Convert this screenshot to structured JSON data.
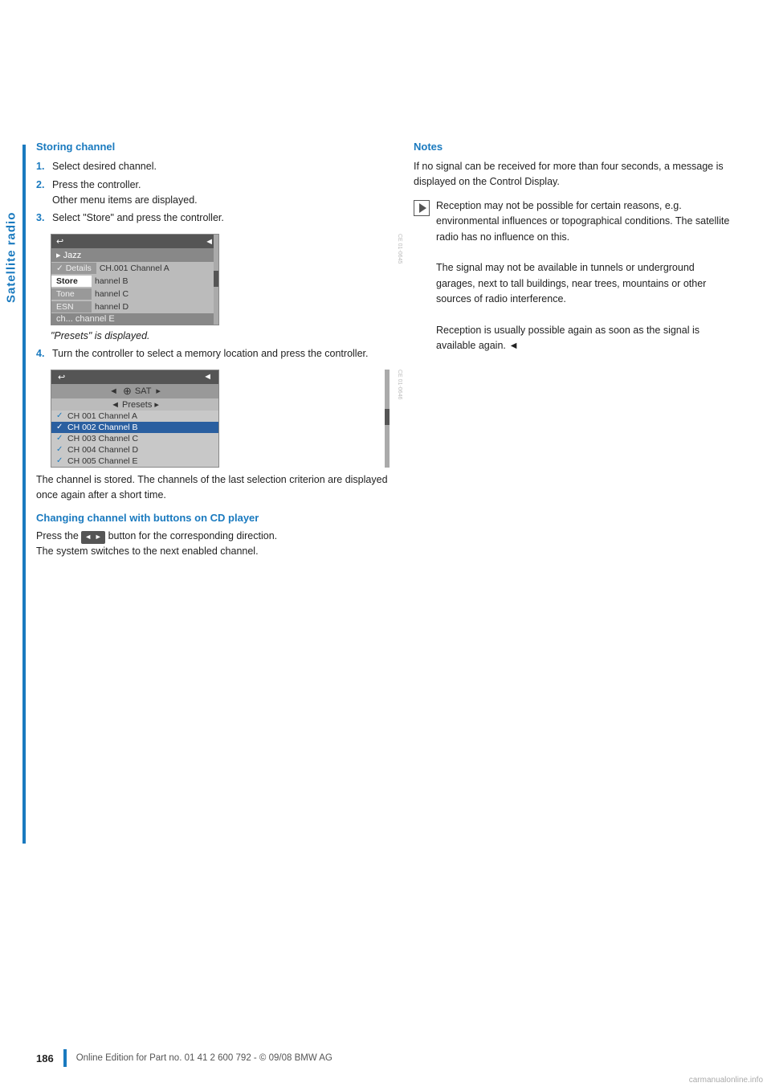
{
  "sidebar": {
    "label": "Satellite radio"
  },
  "left_col": {
    "storing_channel": {
      "title": "Storing channel",
      "steps": [
        {
          "num": "1.",
          "text": "Select desired channel."
        },
        {
          "num": "2.",
          "text": "Press the controller.\nOther menu items are displayed."
        },
        {
          "num": "3.",
          "text": "Select \"Store\" and press the controller."
        }
      ],
      "screen1": {
        "top_icon": "◄",
        "jazz": "▸ Jazz",
        "rows": [
          {
            "label": "Details",
            "content": "CH.001 Channel A"
          },
          {
            "label": "Store",
            "content": "hannel B",
            "active": true
          },
          {
            "label": "Tone",
            "content": "hannel C"
          },
          {
            "label": "ESN",
            "content": "hannel D"
          },
          {
            "content2": "ch... channel E"
          }
        ]
      },
      "presets_note": "\"Presets\" is displayed.",
      "step4": {
        "num": "4.",
        "text": "Turn the controller to select a memory location and press the controller."
      },
      "screen2": {
        "arrow_left": "◄",
        "sat_label": "SAT",
        "arrow_right": "▸",
        "top_icon": "◄",
        "presets": "◄ Presets ▸",
        "channels": [
          {
            "check": "✓",
            "name": "CH 001 Channel A",
            "highlighted": false
          },
          {
            "check": "✓",
            "name": "CH 002 Channel B",
            "highlighted": true
          },
          {
            "check": "✓",
            "name": "CH 003 Channel C",
            "highlighted": false
          },
          {
            "check": "✓",
            "name": "CH 004 Channel D",
            "highlighted": false
          },
          {
            "check": "✓",
            "name": "CH 005 Channel E",
            "highlighted": false
          }
        ]
      },
      "stored_text": "The channel is stored. The channels of the last selection criterion are displayed once again after a short time."
    },
    "changing_channel": {
      "title": "Changing channel with buttons on CD player",
      "button_label": "◄ ►",
      "text1": "Press the",
      "text2": "button for the corresponding direction.",
      "text3": "The system switches to the next enabled channel."
    }
  },
  "right_col": {
    "notes": {
      "title": "Notes",
      "para1": "If no signal can be received for more than four seconds, a message is displayed on the Control Display.",
      "icon_note": "Reception may not be possible for certain reasons, e.g. environmental influences or topographical conditions. The satellite radio has no influence on this.\nThe signal may not be available in tunnels or underground garages, next to tall buildings, near trees, mountains or other sources of radio interference.\nReception is usually possible again as soon as the signal is available again."
    }
  },
  "footer": {
    "page_num": "186",
    "bar_color": "#1a7abf",
    "text": "Online Edition for Part no. 01 41 2 600 792 - © 09/08 BMW AG"
  },
  "watermark": "carmanualonline.info"
}
